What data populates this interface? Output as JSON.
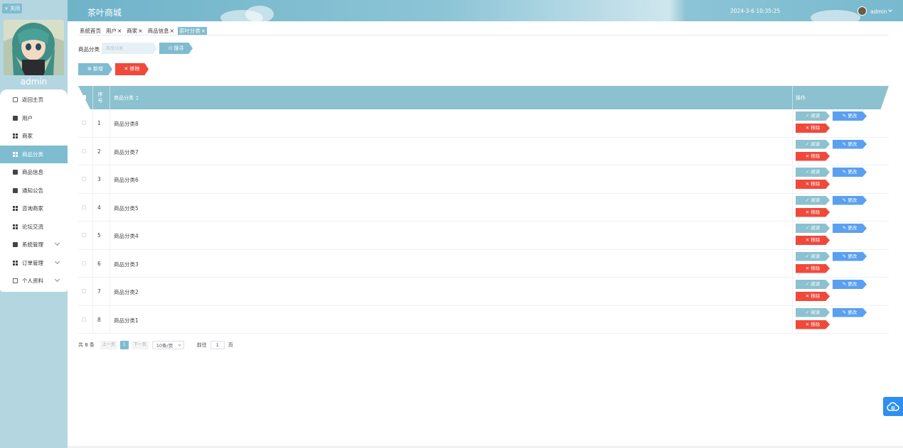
{
  "sidebar": {
    "close_label": "× 关闭",
    "username": "admin",
    "menu": [
      {
        "label": "返回主页",
        "icon": "home-icon",
        "active": false,
        "expandable": false
      },
      {
        "label": "用户",
        "icon": "user-icon",
        "active": false,
        "expandable": false
      },
      {
        "label": "商家",
        "icon": "grid-icon",
        "active": false,
        "expandable": false
      },
      {
        "label": "商品分类",
        "icon": "grid-icon",
        "active": true,
        "expandable": false
      },
      {
        "label": "商品信息",
        "icon": "box-icon",
        "active": false,
        "expandable": false
      },
      {
        "label": "通知公告",
        "icon": "megaphone-icon",
        "active": false,
        "expandable": false
      },
      {
        "label": "咨询商家",
        "icon": "grid-icon",
        "active": false,
        "expandable": false
      },
      {
        "label": "论坛交流",
        "icon": "grid-icon",
        "active": false,
        "expandable": false
      },
      {
        "label": "系统管理",
        "icon": "chart-icon",
        "active": false,
        "expandable": true
      },
      {
        "label": "订单管理",
        "icon": "grid-icon",
        "active": false,
        "expandable": true
      },
      {
        "label": "个人资料",
        "icon": "card-icon",
        "active": false,
        "expandable": true
      }
    ]
  },
  "header": {
    "title": "茶叶商城",
    "datetime": "2024-3-6 10:35:25",
    "user": "admin"
  },
  "tabs": [
    {
      "label": "系统首页",
      "closable": false,
      "active": false
    },
    {
      "label": "用户",
      "closable": true,
      "active": false
    },
    {
      "label": "商家",
      "closable": true,
      "active": false
    },
    {
      "label": "商品信息",
      "closable": true,
      "active": false
    },
    {
      "label": "茶叶分类",
      "closable": true,
      "active": true
    }
  ],
  "search": {
    "label": "商品分类",
    "placeholder": "商品分类",
    "button": "⊙ 搜寻"
  },
  "actions": {
    "add": "⊕ 新增",
    "remove": "✕ 移除"
  },
  "table": {
    "columns": {
      "index": "序号",
      "name": "商品分类",
      "ops": "操作"
    },
    "row_buttons": {
      "view": "✓ 阅读",
      "edit": "✎ 更改",
      "remove": "✕ 移除"
    },
    "rows": [
      {
        "index": "1",
        "name": "商品分类8"
      },
      {
        "index": "2",
        "name": "商品分类7"
      },
      {
        "index": "3",
        "name": "商品分类6"
      },
      {
        "index": "4",
        "name": "商品分类5"
      },
      {
        "index": "5",
        "name": "商品分类4"
      },
      {
        "index": "6",
        "name": "商品分类3"
      },
      {
        "index": "7",
        "name": "商品分类2"
      },
      {
        "index": "8",
        "name": "商品分类1"
      }
    ]
  },
  "pagination": {
    "total": "共 8 条",
    "prev": "上一页",
    "current": "1",
    "next": "下一页",
    "page_size": "10条/页",
    "goto_label": "前往",
    "goto_value": "1",
    "goto_suffix": "页"
  },
  "colors": {
    "accent": "#7fbcd0",
    "sidebar_bg": "#b4d6e1",
    "danger": "#f0493b",
    "edit": "#5aa0f0",
    "float_button": "#2f8ff0"
  }
}
